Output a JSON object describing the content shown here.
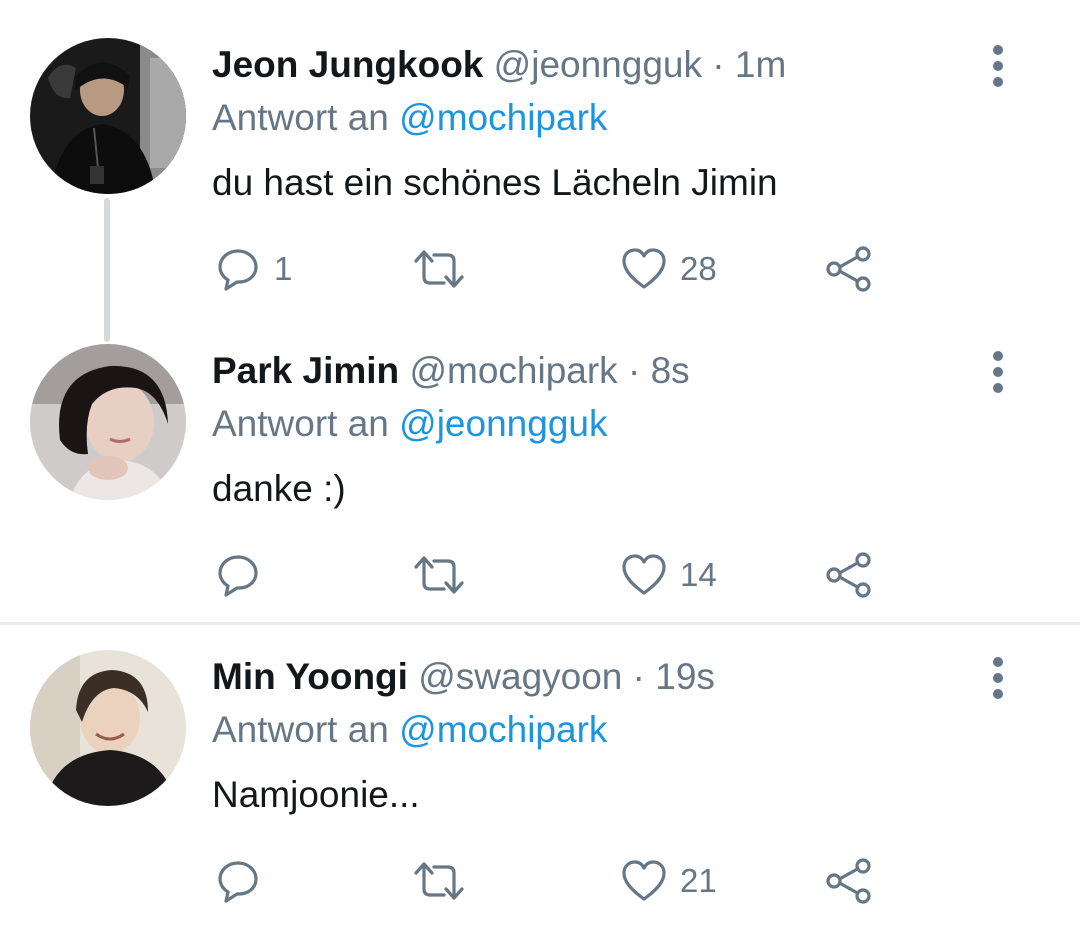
{
  "colors": {
    "link": "#1b95e0",
    "secondary_text": "#657786",
    "primary_text": "#14171a",
    "thread_line": "#d4d9dd",
    "divider": "#e6ecf0"
  },
  "icons": {
    "reply": "speech-bubble-icon",
    "retweet": "retweet-arrows-icon",
    "like": "heart-outline-icon",
    "share": "share-nodes-icon",
    "more": "vertical-dots-icon"
  },
  "tweets": [
    {
      "name": "Jeon Jungkook",
      "handle": "@jeonngguk",
      "separator": "·",
      "time": "1m",
      "reply_prefix": "Antwort an",
      "reply_to": "@mochipark",
      "text": "du hast ein schönes Lächeln Jimin",
      "replies": "1",
      "retweets": "",
      "likes": "28"
    },
    {
      "name": "Park Jimin",
      "handle": "@mochipark",
      "separator": "·",
      "time": "8s",
      "reply_prefix": "Antwort an",
      "reply_to": "@jeonngguk",
      "text": "danke :)",
      "replies": "",
      "retweets": "",
      "likes": "14"
    },
    {
      "name": "Min Yoongi",
      "handle": "@swagyoon",
      "separator": "·",
      "time": "19s",
      "reply_prefix": "Antwort an",
      "reply_to": "@mochipark",
      "text": "Namjoonie...",
      "replies": "",
      "retweets": "",
      "likes": "21"
    }
  ]
}
